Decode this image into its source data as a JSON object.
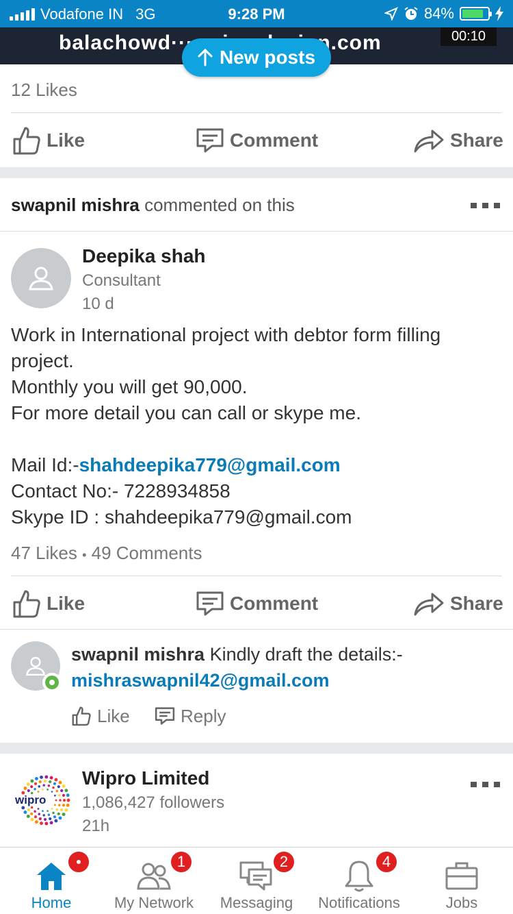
{
  "status_bar": {
    "carrier": "Vodafone IN",
    "network": "3G",
    "time": "9:28 PM",
    "battery": "84%",
    "battery_level": 0.84
  },
  "banner": {
    "email_text": "balachowd··· ···ius design.com",
    "timer": "00:10"
  },
  "new_posts_label": "New posts",
  "post1": {
    "likes": "12 Likes"
  },
  "actions": {
    "like": "Like",
    "comment": "Comment",
    "share": "Share"
  },
  "activity": {
    "actor": "swapnil mishra",
    "verb": "commented on this"
  },
  "post2": {
    "author": "Deepika shah",
    "headline": "Consultant",
    "age": "10 d",
    "body_lines": [
      "Work in International project with debtor form filling",
      "project.",
      "Monthly you will get 90,000.",
      "For more detail you can call or skype me."
    ],
    "mail_label": "Mail Id:-",
    "mail_value": "shahdeepika779@gmail.com",
    "contact_line": "Contact No:- 7228934858",
    "skype_line": "Skype ID : shahdeepika779@gmail.com",
    "likes": "47 Likes",
    "separator": "•",
    "comments": "49 Comments"
  },
  "comment": {
    "author": "swapnil mishra",
    "text": "Kindly draft the details:-",
    "email": "mishraswapnil42@gmail.com",
    "like": "Like",
    "reply": "Reply"
  },
  "post3": {
    "company": "Wipro Limited",
    "logo_text": "wipro",
    "followers": "1,086,427 followers",
    "age": "21h"
  },
  "nav": {
    "home": "Home",
    "network": "My Network",
    "network_badge": "1",
    "messaging": "Messaging",
    "messaging_badge": "2",
    "notifications": "Notifications",
    "notifications_badge": "4",
    "jobs": "Jobs"
  },
  "colors": {
    "brand_blue": "#0a84c4",
    "link_blue": "#0b7bb8",
    "badge_red": "#e02020",
    "online_green": "#5fb548"
  }
}
